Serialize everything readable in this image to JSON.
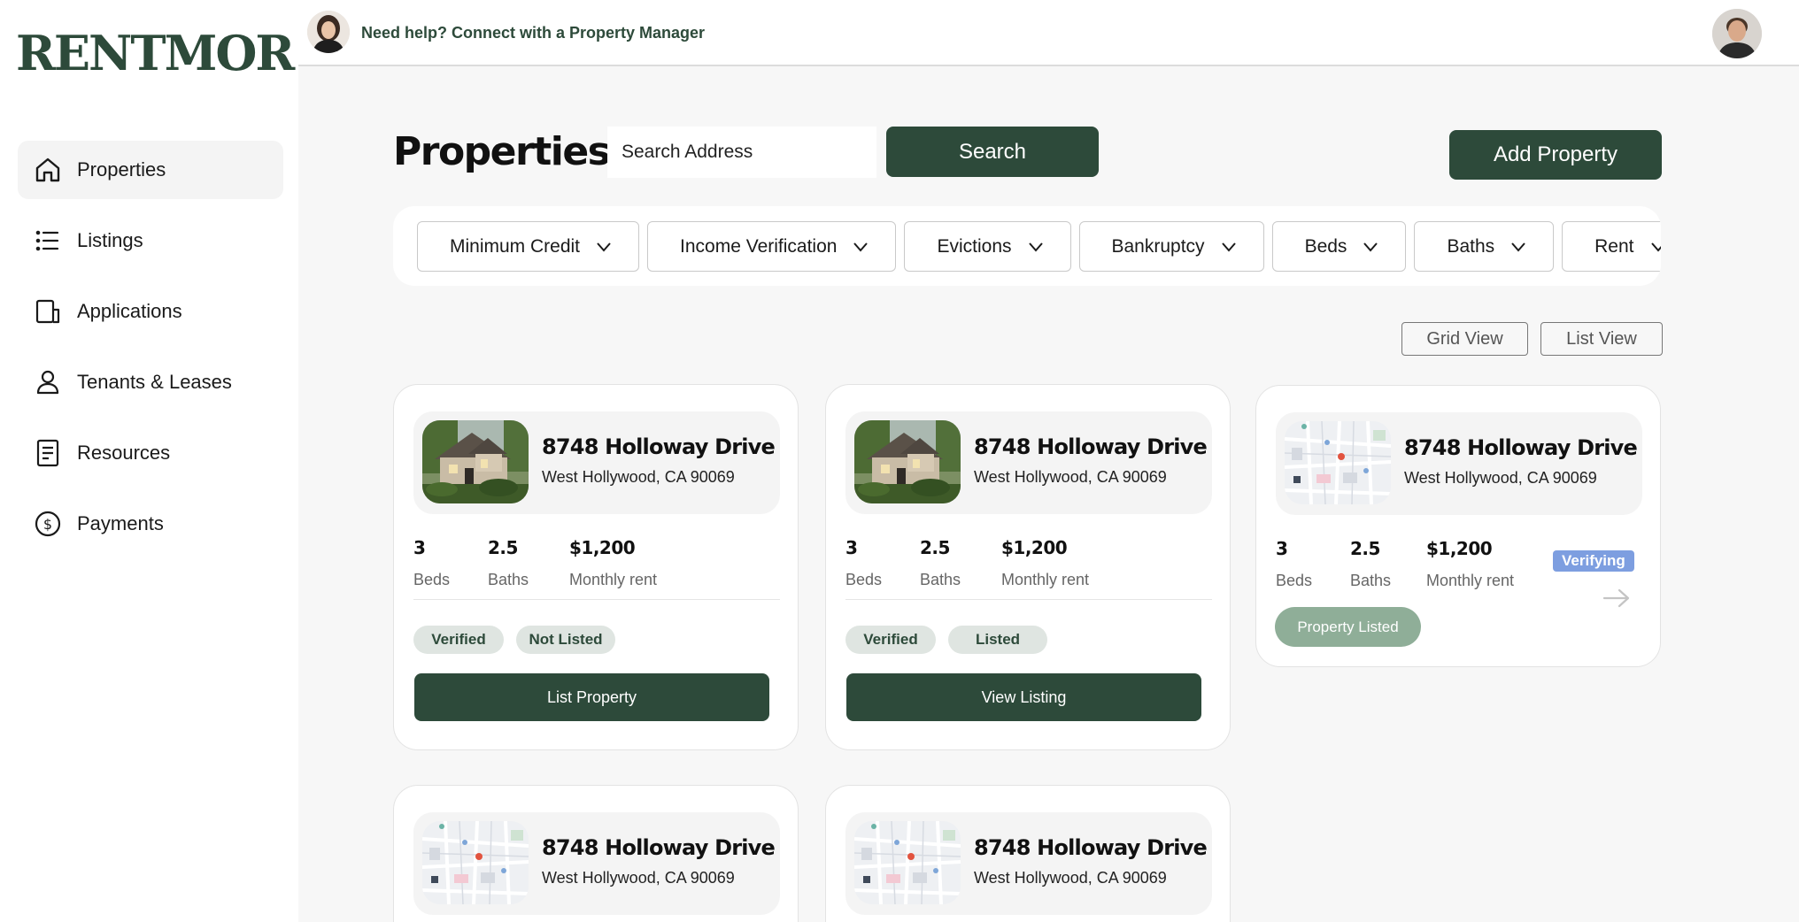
{
  "brand": {
    "logo": "RENTMOR"
  },
  "header": {
    "help_text": "Need help? Connect with a Property Manager"
  },
  "sidebar": {
    "items": [
      {
        "label": "Properties",
        "icon": "home-icon",
        "active": true
      },
      {
        "label": "Listings",
        "icon": "list-icon"
      },
      {
        "label": "Applications",
        "icon": "applications-icon"
      },
      {
        "label": "Tenants & Leases",
        "icon": "user-icon"
      },
      {
        "label": "Resources",
        "icon": "document-icon"
      },
      {
        "label": "Payments",
        "icon": "dollar-icon"
      }
    ]
  },
  "main": {
    "title": "Properties",
    "search": {
      "placeholder": "Search Address",
      "button": "Search"
    },
    "add_button": "Add Property",
    "filters": [
      "Minimum Credit",
      "Income Verification",
      "Evictions",
      "Bankruptcy",
      "Beds",
      "Baths",
      "Rent"
    ],
    "views": {
      "grid": "Grid View",
      "list": "List View"
    }
  },
  "cards": [
    {
      "address": "8748 Holloway Drive",
      "city": "West Hollywood, CA 90069",
      "beds": "3",
      "beds_label": "Beds",
      "baths": "2.5",
      "baths_label": "Baths",
      "rent": "$1,200",
      "rent_label": "Monthly rent",
      "badge1": "Verified",
      "badge2": "Not Listed",
      "button": "List Property"
    },
    {
      "address": "8748 Holloway Drive",
      "city": "West Hollywood, CA 90069",
      "beds": "3",
      "beds_label": "Beds",
      "baths": "2.5",
      "baths_label": "Baths",
      "rent": "$1,200",
      "rent_label": "Monthly rent",
      "badge1": "Verified",
      "badge2": "Listed",
      "button": "View Listing"
    },
    {
      "address": "8748 Holloway Drive",
      "city": "West Hollywood, CA 90069",
      "beds": "3",
      "beds_label": "Beds",
      "baths": "2.5",
      "baths_label": "Baths",
      "rent": "$1,200",
      "rent_label": "Monthly rent",
      "status": "Verifying",
      "button": "Property Listed"
    },
    {
      "address": "8748 Holloway Drive",
      "city": "West Hollywood, CA 90069"
    },
    {
      "address": "8748 Holloway Drive",
      "city": "West Hollywood, CA 90069"
    }
  ],
  "colors": {
    "brand": "#2d4a3a",
    "verifying": "#7d9ee0",
    "listed_pill": "#8fae98",
    "badge_bg": "#dfe5e1"
  }
}
